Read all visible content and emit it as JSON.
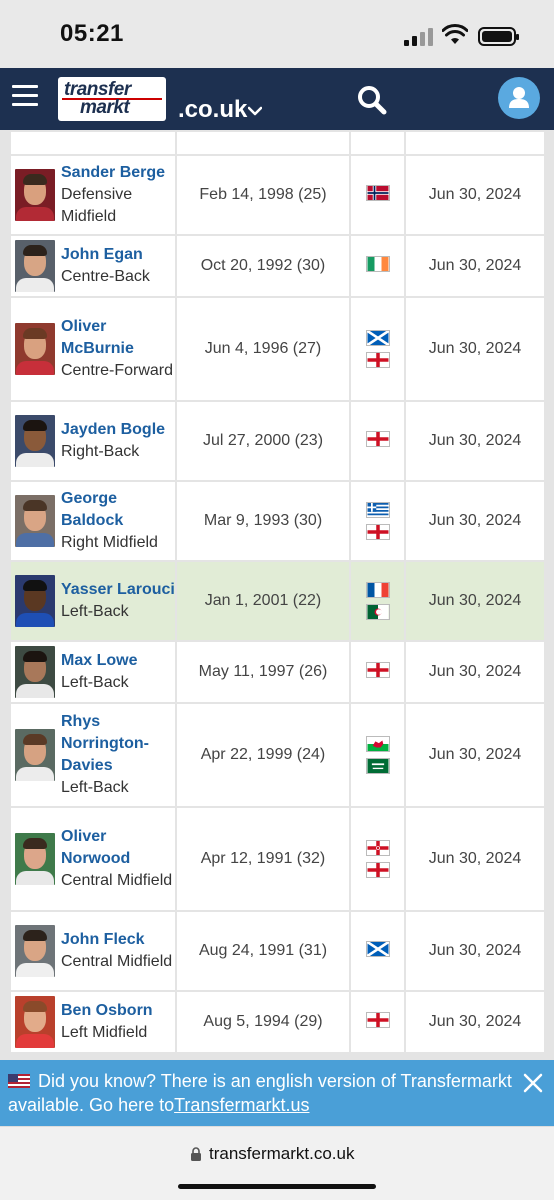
{
  "status": {
    "time": "05:21"
  },
  "header": {
    "logo_line1": "transfer",
    "logo_line2": "markt",
    "domain": ".co.uk"
  },
  "players": [
    {
      "name": "Sander Berge",
      "position": "Defensive Midfield",
      "dob": "Feb 14, 1998 (25)",
      "flags": [
        "norway"
      ],
      "contract": "Jun 30, 2024",
      "highlight": false
    },
    {
      "name": "John Egan",
      "position": "Centre-Back",
      "dob": "Oct 20, 1992 (30)",
      "flags": [
        "ireland"
      ],
      "contract": "Jun 30, 2024",
      "highlight": false
    },
    {
      "name": "Oliver McBurnie",
      "position": "Centre-Forward",
      "dob": "Jun 4, 1996 (27)",
      "flags": [
        "scotland",
        "england"
      ],
      "contract": "Jun 30, 2024",
      "highlight": false
    },
    {
      "name": "Jayden Bogle",
      "position": "Right-Back",
      "dob": "Jul 27, 2000 (23)",
      "flags": [
        "england"
      ],
      "contract": "Jun 30, 2024",
      "highlight": false
    },
    {
      "name": "George Baldock",
      "position": "Right Midfield",
      "dob": "Mar 9, 1993 (30)",
      "flags": [
        "greece",
        "england"
      ],
      "contract": "Jun 30, 2024",
      "highlight": false
    },
    {
      "name": "Yasser Larouci",
      "position": "Left-Back",
      "dob": "Jan 1, 2001 (22)",
      "flags": [
        "france",
        "algeria"
      ],
      "contract": "Jun 30, 2024",
      "highlight": true
    },
    {
      "name": "Max Lowe",
      "position": "Left-Back",
      "dob": "May 11, 1997 (26)",
      "flags": [
        "england"
      ],
      "contract": "Jun 30, 2024",
      "highlight": false
    },
    {
      "name": "Rhys Norrington-Davies",
      "position": "Left-Back",
      "dob": "Apr 22, 1999 (24)",
      "flags": [
        "wales",
        "saudi-arabia"
      ],
      "contract": "Jun 30, 2024",
      "highlight": false
    },
    {
      "name": "Oliver Norwood",
      "position": "Central Midfield",
      "dob": "Apr 12, 1991 (32)",
      "flags": [
        "northern-ireland",
        "england"
      ],
      "contract": "Jun 30, 2024",
      "highlight": false
    },
    {
      "name": "John Fleck",
      "position": "Central Midfield",
      "dob": "Aug 24, 1991 (31)",
      "flags": [
        "scotland"
      ],
      "contract": "Jun 30, 2024",
      "highlight": false
    },
    {
      "name": "Ben Osborn",
      "position": "Left Midfield",
      "dob": "Aug 5, 1994 (29)",
      "flags": [
        "england"
      ],
      "contract": "Jun 30, 2024",
      "highlight": false
    }
  ],
  "banner": {
    "text": "Did you know? There is an english version of Transfermarkt available. Go here to",
    "link": "Transfermarkt.us"
  },
  "urlbar": {
    "url": "transfermarkt.co.uk"
  },
  "colors": {
    "header": "#1d3050",
    "link": "#1d5fa0",
    "banner": "#4a9fd7",
    "highlight_row": "#e1ecd6"
  }
}
